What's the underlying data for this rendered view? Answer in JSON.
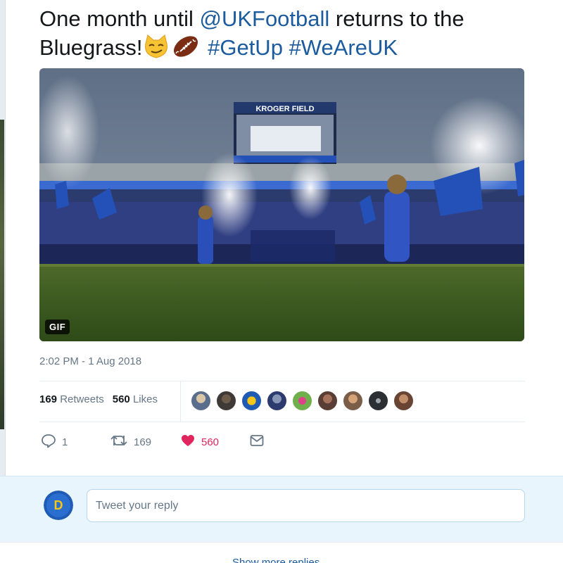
{
  "tweet": {
    "text_part1": "One month until ",
    "mention": "@UKFootball",
    "text_part2": " returns to the",
    "text_part3": "Bluegrass!",
    "hashtag1": "#GetUp",
    "hashtag2": "#WeAreUK",
    "emoji_1": "smirking-cat-emoji",
    "emoji_2": "american-football-emoji"
  },
  "media": {
    "badge": "GIF",
    "scoreboard_text": "KROGER FIELD"
  },
  "timestamp": "2:02 PM - 1 Aug 2018",
  "stats": {
    "retweets_count": "169",
    "retweets_label": "Retweets",
    "likes_count": "560",
    "likes_label": "Likes"
  },
  "actions": {
    "reply_count": "1",
    "retweet_count": "169",
    "like_count": "560"
  },
  "colors": {
    "link": "#1b5b9e",
    "like": "#e0245e",
    "muted": "#657786",
    "reply_bg": "#e8f5fd"
  },
  "reply": {
    "placeholder": "Tweet your reply",
    "avatar_text": "D"
  },
  "more_replies": "Show more replies"
}
